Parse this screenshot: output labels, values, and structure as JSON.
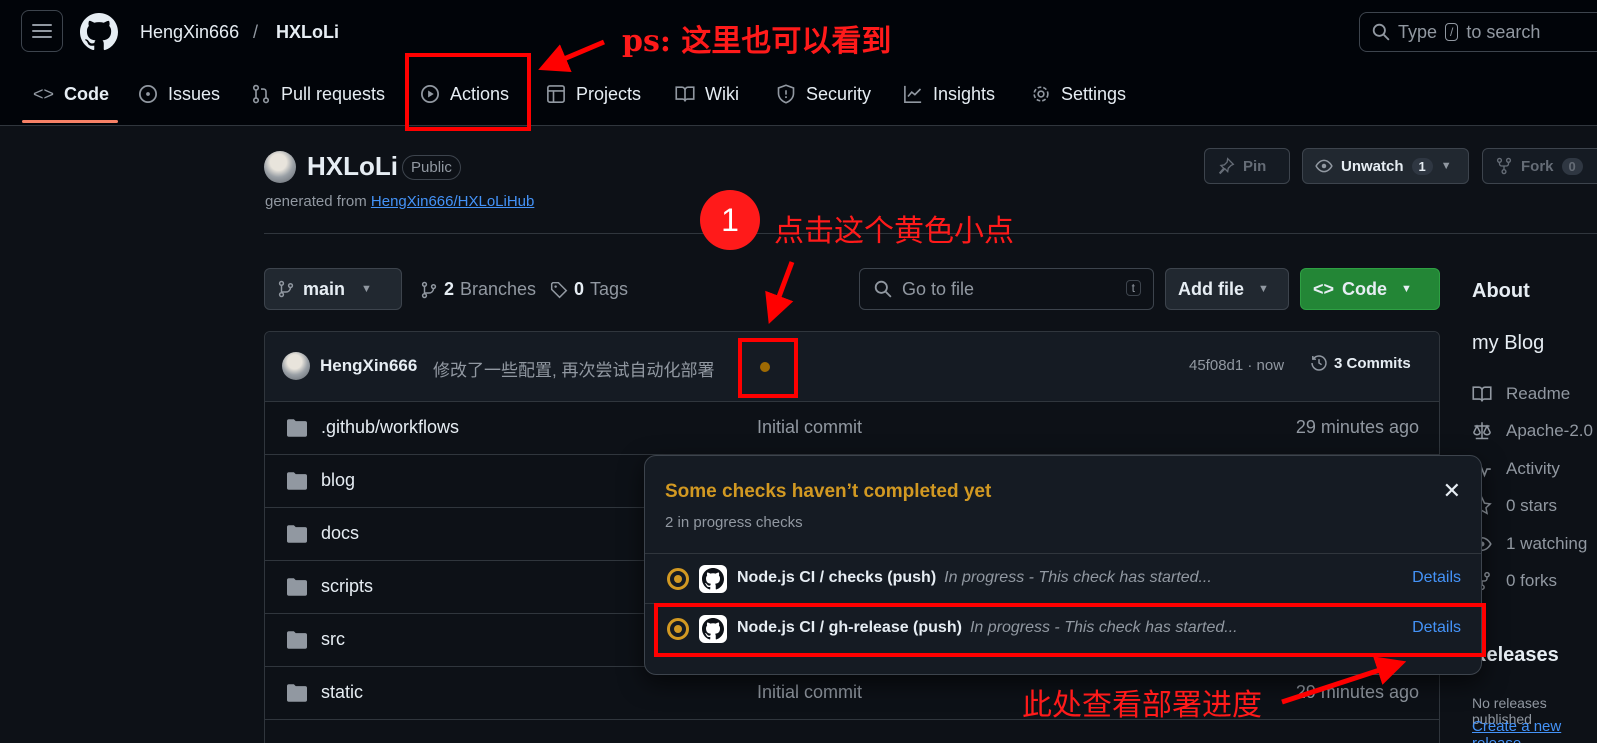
{
  "header": {
    "owner": "HengXin666",
    "separator": "/",
    "repo": "HXLoLi",
    "search_prefix": "Type",
    "search_key": "/",
    "search_suffix": "to search"
  },
  "tabs": [
    {
      "label": "Code",
      "icon": "code-icon"
    },
    {
      "label": "Issues",
      "icon": "issue-icon"
    },
    {
      "label": "Pull requests",
      "icon": "pull-request-icon"
    },
    {
      "label": "Actions",
      "icon": "play-icon"
    },
    {
      "label": "Projects",
      "icon": "table-icon"
    },
    {
      "label": "Wiki",
      "icon": "book-icon"
    },
    {
      "label": "Security",
      "icon": "shield-icon"
    },
    {
      "label": "Insights",
      "icon": "graph-icon"
    },
    {
      "label": "Settings",
      "icon": "gear-icon"
    }
  ],
  "repo": {
    "name": "HXLoLi",
    "visibility": "Public",
    "generated_prefix": "generated from",
    "template_link": "HengXin666/HXLoLiHub",
    "pin_label": "Pin",
    "unwatch_label": "Unwatch",
    "watch_count": "1",
    "fork_label": "Fork",
    "fork_count": "0"
  },
  "toolbar": {
    "branch": "main",
    "branches_count": "2",
    "branches_label": "Branches",
    "tags_count": "0",
    "tags_label": "Tags",
    "goto_placeholder": "Go to file",
    "goto_key": "t",
    "add_file": "Add file",
    "code": "Code"
  },
  "latest_commit": {
    "author": "HengXin666",
    "message": "修改了一些配置, 再次尝试自动化部署",
    "hash_time": "45f08d1 · now",
    "commits_label": "3 Commits"
  },
  "files": [
    {
      "name": ".github/workflows",
      "message": "Initial commit",
      "time": "29 minutes ago"
    },
    {
      "name": "blog",
      "message": "",
      "time": ""
    },
    {
      "name": "docs",
      "message": "",
      "time": ""
    },
    {
      "name": "scripts",
      "message": "",
      "time": ""
    },
    {
      "name": "src",
      "message": "",
      "time": ""
    },
    {
      "name": "static",
      "message": "Initial commit",
      "time": "29 minutes ago"
    }
  ],
  "sidebar": {
    "about": "About",
    "description": "my Blog",
    "items": [
      {
        "label": "Readme",
        "icon": "book-icon"
      },
      {
        "label": "Apache-2.0",
        "icon": "law-icon"
      },
      {
        "label": "Activity",
        "icon": "pulse-icon"
      },
      {
        "label": "0 stars",
        "icon": "star-icon"
      },
      {
        "label": "1 watching",
        "icon": "eye-icon"
      },
      {
        "label": "0 forks",
        "icon": "fork-icon"
      }
    ],
    "releases": "Releases",
    "no_releases": "No releases published",
    "create_release": "Create a new release"
  },
  "checks_popover": {
    "title": "Some checks haven’t completed yet",
    "subtitle": "2 in progress checks",
    "close": "✕",
    "checks": [
      {
        "name": "Node.js CI / checks (push)",
        "status": "In progress - This check has started...",
        "details": "Details"
      },
      {
        "name": "Node.js CI / gh-release (push)",
        "status": "In progress - This check has started...",
        "details": "Details"
      }
    ]
  },
  "annotations": {
    "ps_note": "ps: 这里也可以看到",
    "step_number": "1",
    "click_note": "点击这个黄色小点",
    "progress_note": "此处查看部署进度"
  },
  "colors": {
    "annotation_red": "#ff0000",
    "in_progress_yellow": "#d29922",
    "code_button_green": "#238636",
    "link_blue": "#4493f8"
  }
}
